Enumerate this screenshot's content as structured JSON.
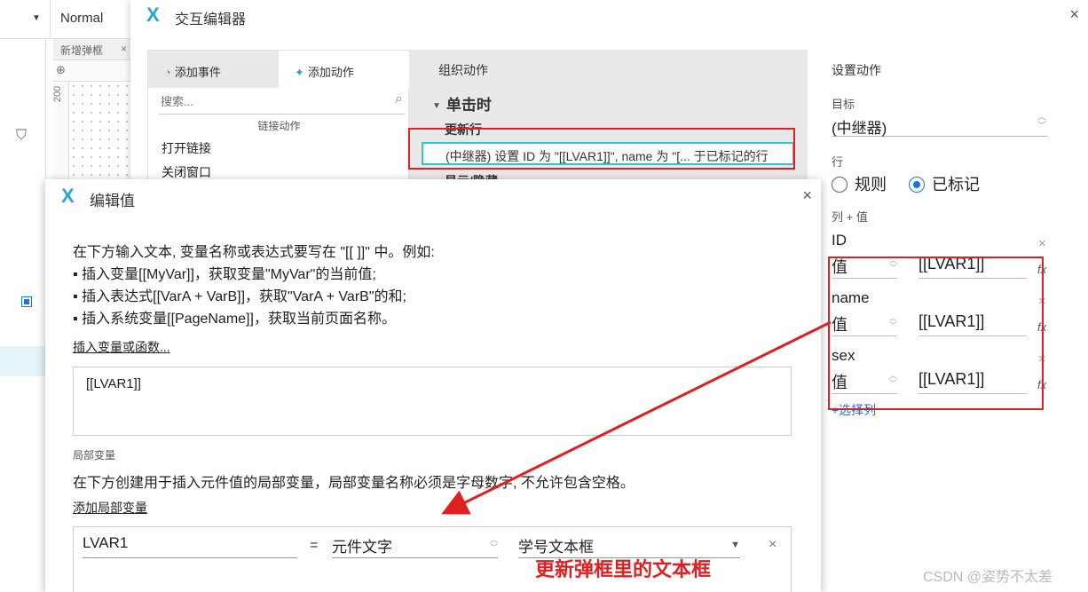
{
  "background_app": {
    "style_selector": "Normal",
    "page_tab": "新增弹框",
    "page_tab_close": "×",
    "ruler_label": "200"
  },
  "interaction_editor": {
    "title": "交互编辑器",
    "close_icon": "×",
    "tabs": {
      "add_event": "添加事件",
      "add_action": "添加动作"
    },
    "search_placeholder": "搜索...",
    "section_link_actions": "链接动作",
    "action_items": [
      "打开链接",
      "关闭窗口"
    ],
    "organize_header": "组织动作",
    "event_name": "单击时",
    "action_name": "更新行",
    "action_row": "(中继器) 设置 ID 为 \"[[LVAR1]]\", name 为 \"[... 于已标记的行",
    "next_action_partial": "显示/隐藏",
    "settings": {
      "title": "设置动作",
      "target_label": "目标",
      "target_value": "(中继器)",
      "row_label": "行",
      "row_options": [
        {
          "label": "规则",
          "selected": false
        },
        {
          "label": "已标记",
          "selected": true
        }
      ],
      "columns_label": "列 + 值",
      "columns": [
        {
          "name": "ID",
          "type": "值",
          "value": "[[LVAR1]]"
        },
        {
          "name": "name",
          "type": "值",
          "value": "[[LVAR1]]"
        },
        {
          "name": "sex",
          "type": "值",
          "value": "[[LVAR1]]"
        }
      ],
      "add_column": "+选择列"
    }
  },
  "edit_value_dialog": {
    "title": "编辑值",
    "close_icon": "×",
    "instructions": [
      "在下方输入文本, 变量名称或表达式要写在 \"[[ ]]\" 中。例如:",
      "▪ 插入变量[[MyVar]]，获取变量\"MyVar\"的当前值;",
      "▪ 插入表达式[[VarA + VarB]]，获取\"VarA + VarB\"的和;",
      "▪ 插入系统变量[[PageName]]，获取当前页面名称。"
    ],
    "insert_link": "插入变量或函数...",
    "expression": "[[LVAR1]]",
    "local_vars_header": "局部变量",
    "local_vars_desc": "在下方创建用于插入元件值的局部变量，局部变量名称必须是字母数字, 不允许包含空格。",
    "add_local_var": "添加局部变量",
    "local_var": {
      "name": "LVAR1",
      "equals": "=",
      "source": "元件文字",
      "widget": "学号文本框"
    }
  },
  "annotation": {
    "note": "更新弹框里的文本框",
    "color": "#e02020"
  },
  "watermark": "CSDN @姿势不太差",
  "colors": {
    "accent": "#22a7d6",
    "highlight": "#2ec7c9",
    "radio": "#1a73e8",
    "annotation": "#e02020"
  }
}
